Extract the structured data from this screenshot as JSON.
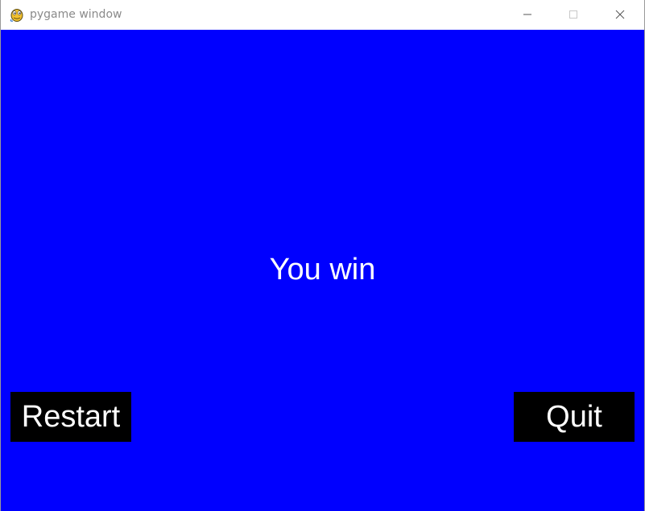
{
  "window": {
    "title": "pygame window",
    "icon": "pygame-snake-icon",
    "controls": {
      "minimize": "minimize-icon",
      "maximize": "maximize-icon",
      "close": "close-icon"
    }
  },
  "game": {
    "background_color": "#0000ff",
    "message": "You win",
    "buttons": {
      "restart_label": "Restart",
      "quit_label": "Quit"
    },
    "button_color": "#000000",
    "text_color": "#ffffff"
  }
}
